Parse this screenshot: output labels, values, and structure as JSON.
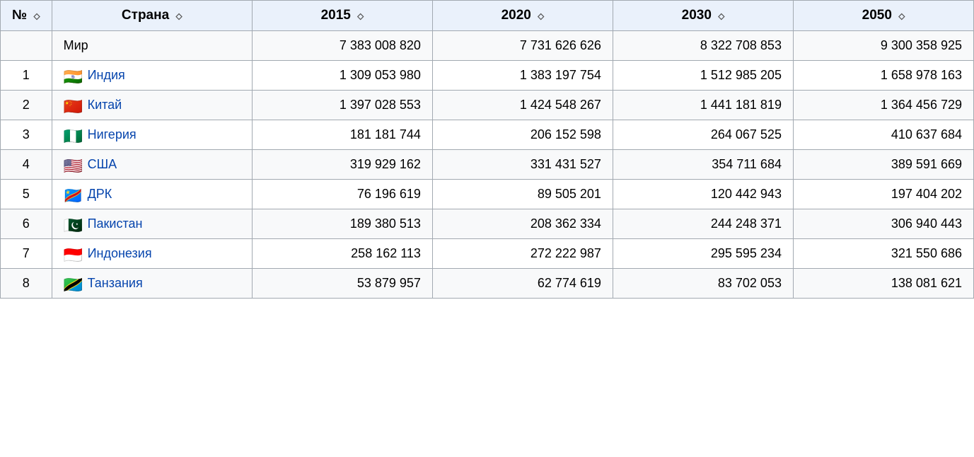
{
  "table": {
    "headers": [
      {
        "label": "№",
        "sort": true,
        "key": "num"
      },
      {
        "label": "Страна",
        "sort": true,
        "key": "country"
      },
      {
        "label": "2015",
        "sort": true,
        "key": "y2015"
      },
      {
        "label": "2020",
        "sort": true,
        "key": "y2020"
      },
      {
        "label": "2030",
        "sort": true,
        "key": "y2030"
      },
      {
        "label": "2050",
        "sort": true,
        "key": "y2050"
      }
    ],
    "world_row": {
      "label": "Мир",
      "y2015": "7 383 008 820",
      "y2020": "7 731 626 626",
      "y2030": "8 322 708 853",
      "y2050": "9 300 358 925"
    },
    "rows": [
      {
        "num": "1",
        "country": "Индия",
        "flag": "🇮🇳",
        "y2015": "1 309 053 980",
        "y2020": "1 383 197 754",
        "y2030": "1 512 985 205",
        "y2050": "1 658 978 163"
      },
      {
        "num": "2",
        "country": "Китай",
        "flag": "🇨🇳",
        "y2015": "1 397 028 553",
        "y2020": "1 424 548 267",
        "y2030": "1 441 181 819",
        "y2050": "1 364 456 729"
      },
      {
        "num": "3",
        "country": "Нигерия",
        "flag": "🇳🇬",
        "y2015": "181 181 744",
        "y2020": "206 152 598",
        "y2030": "264 067 525",
        "y2050": "410 637 684"
      },
      {
        "num": "4",
        "country": "США",
        "flag": "🇺🇸",
        "y2015": "319 929 162",
        "y2020": "331 431 527",
        "y2030": "354 711 684",
        "y2050": "389 591 669"
      },
      {
        "num": "5",
        "country": "ДРК",
        "flag": "🇨🇩",
        "y2015": "76 196 619",
        "y2020": "89 505 201",
        "y2030": "120 442 943",
        "y2050": "197 404 202"
      },
      {
        "num": "6",
        "country": "Пакистан",
        "flag": "🇵🇰",
        "y2015": "189 380 513",
        "y2020": "208 362 334",
        "y2030": "244 248 371",
        "y2050": "306 940 443"
      },
      {
        "num": "7",
        "country": "Индонезия",
        "flag": "🇮🇩",
        "y2015": "258 162 113",
        "y2020": "272 222 987",
        "y2030": "295 595 234",
        "y2050": "321 550 686"
      },
      {
        "num": "8",
        "country": "Танзания",
        "flag": "🇹🇿",
        "y2015": "53 879 957",
        "y2020": "62 774 619",
        "y2030": "83 702 053",
        "y2050": "138 081 621"
      }
    ]
  }
}
